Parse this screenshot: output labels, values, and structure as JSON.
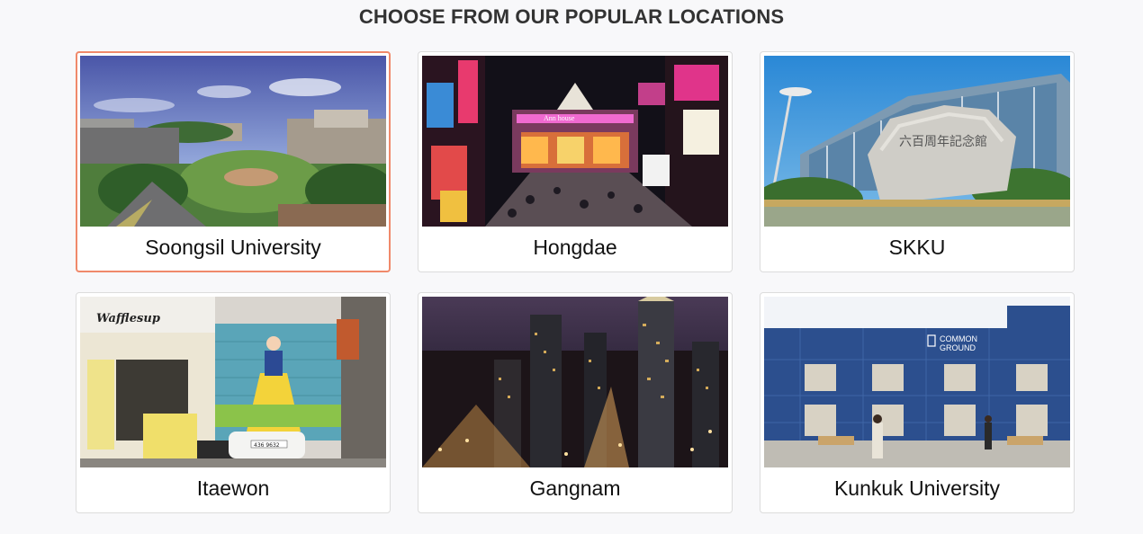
{
  "heading": "CHOOSE FROM OUR POPULAR LOCATIONS",
  "colors": {
    "selected_border": "#f0896a",
    "card_border": "#dcdcdc",
    "background": "#f8f8fa"
  },
  "locations": [
    {
      "name": "Soongsil University",
      "selected": true
    },
    {
      "name": "Hongdae",
      "selected": false
    },
    {
      "name": "SKKU",
      "selected": false
    },
    {
      "name": "Itaewon",
      "selected": false
    },
    {
      "name": "Gangnam",
      "selected": false
    },
    {
      "name": "Kunkuk University",
      "selected": false
    }
  ],
  "photo_text": {
    "itaewon_sign": "Wafflesup",
    "itaewon_plate": "436 9632",
    "kunkuk_sign_1": "COMMON",
    "kunkuk_sign_2": "GROUND",
    "skku_stone": "六百周年記念館",
    "hongdae_sign": "Ann house"
  }
}
